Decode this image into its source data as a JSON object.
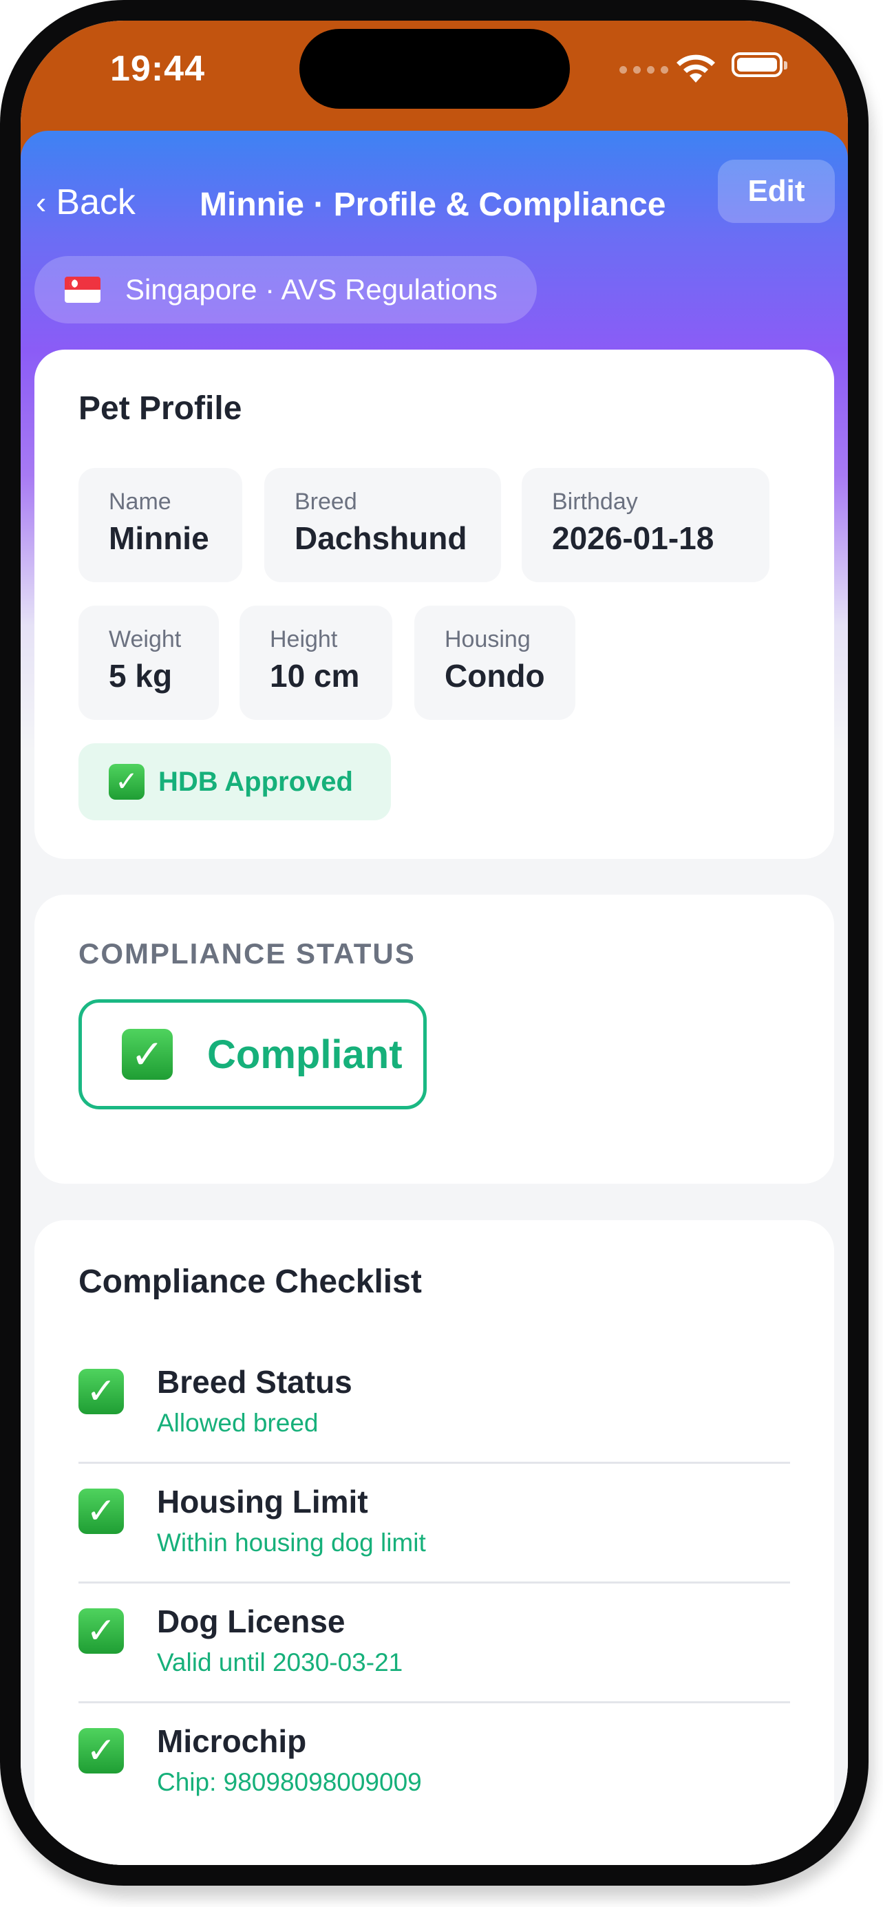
{
  "status_bar": {
    "time": "19:44"
  },
  "nav": {
    "back_label": "Back",
    "title": "Minnie · Profile & Compliance",
    "edit_label": "Edit"
  },
  "region": {
    "flag_icon": "singapore-flag-icon",
    "label": "Singapore · AVS Regulations"
  },
  "pet_profile": {
    "title": "Pet Profile",
    "fields": [
      {
        "label": "Name",
        "value": "Minnie"
      },
      {
        "label": "Breed",
        "value": "Dachshund"
      },
      {
        "label": "Birthday",
        "value": "2026-01-18"
      },
      {
        "label": "Weight",
        "value": "5 kg"
      },
      {
        "label": "Height",
        "value": "10 cm"
      },
      {
        "label": "Housing",
        "value": "Condo"
      }
    ],
    "badge": {
      "icon": "check-mark-icon",
      "label": "HDB Approved"
    }
  },
  "compliance_status": {
    "section_label": "COMPLIANCE STATUS",
    "status": "Compliant",
    "status_color": "#16b07a"
  },
  "checklist": {
    "title": "Compliance Checklist",
    "items": [
      {
        "title": "Breed Status",
        "detail": "Allowed breed"
      },
      {
        "title": "Housing Limit",
        "detail": "Within housing dog limit"
      },
      {
        "title": "Dog License",
        "detail": "Valid until 2030-03-21"
      },
      {
        "title": "Microchip",
        "detail": "Chip: 98098098009009"
      }
    ]
  },
  "colors": {
    "status_bar": "#c2540f",
    "header_gradient_top": "#3e82f3",
    "header_gradient_mid": "#8b5cf6",
    "success_green": "#16b07a",
    "background": "#f4f5f7"
  }
}
